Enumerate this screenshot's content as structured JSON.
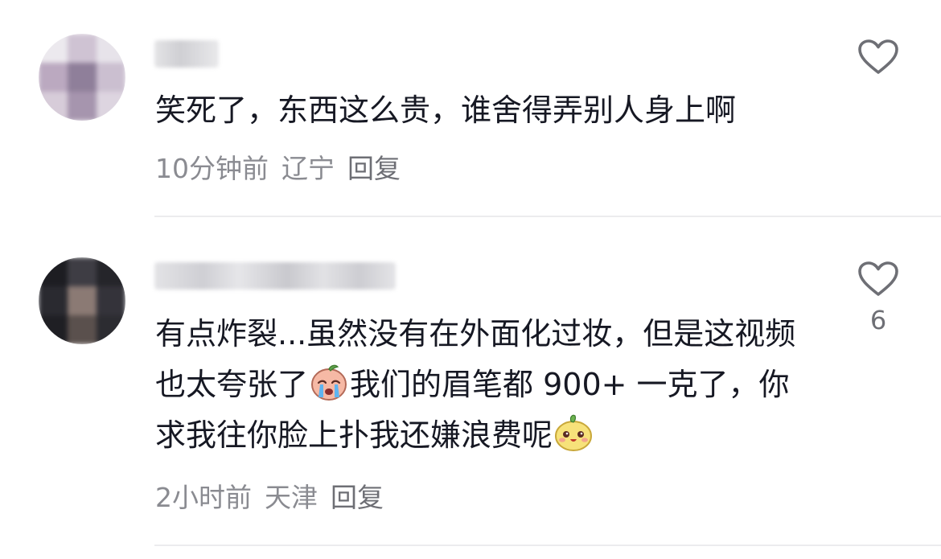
{
  "comments": [
    {
      "username": "",
      "text": "笑死了，东西这么贵，谁舍得弄别人身上啊",
      "time": "10分钟前",
      "location": "辽宁",
      "reply_label": "回复",
      "like_count": ""
    },
    {
      "username": "",
      "text_part1": "有点炸裂...虽然没有在外面化过妆，但是这视频也太夸张了",
      "text_part2": "我们的眉笔都 900+ 一克了，你求我往你脸上扑我还嫌浪费呢",
      "emojis": [
        "crying-face-emoji",
        "smiling-face-emoji"
      ],
      "time": "2小时前",
      "location": "天津",
      "reply_label": "回复",
      "like_count": "6"
    }
  ],
  "colors": {
    "text": "#161823",
    "meta": "#8a8b91",
    "divider": "#ececee",
    "icon": "#6e6f75"
  }
}
